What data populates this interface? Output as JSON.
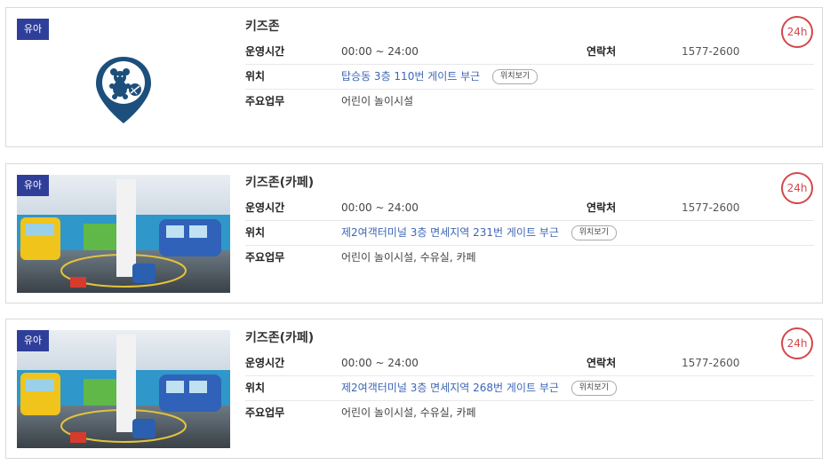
{
  "cards": [
    {
      "badge": "유아",
      "title": "키즈존",
      "hours_badge": "24h",
      "hours_label": "운영시간",
      "hours_value": "00:00 ~ 24:00",
      "contact_label": "연락처",
      "contact_value": "1577-2600",
      "location_label": "위치",
      "location_value": "탑승동 3층 110번 게이트 부근",
      "map_button": "위치보기",
      "duty_label": "주요업무",
      "duty_value": "어린이 놀이시설",
      "image": "kidzone-location-pin-icon"
    },
    {
      "badge": "유아",
      "title": "키즈존(카페)",
      "hours_badge": "24h",
      "hours_label": "운영시간",
      "hours_value": "00:00 ~ 24:00",
      "contact_label": "연락처",
      "contact_value": "1577-2600",
      "location_label": "위치",
      "location_value": "제2여객터미널 3층 면세지역 231번 게이트 부근",
      "map_button": "위치보기",
      "duty_label": "주요업무",
      "duty_value": "어린이 놀이시설, 수유실, 카페",
      "image": "kidzone-photo"
    },
    {
      "badge": "유아",
      "title": "키즈존(카페)",
      "hours_badge": "24h",
      "hours_label": "운영시간",
      "hours_value": "00:00 ~ 24:00",
      "contact_label": "연락처",
      "contact_value": "1577-2600",
      "location_label": "위치",
      "location_value": "제2여객터미널 3층 면세지역 268번 게이트 부근",
      "map_button": "위치보기",
      "duty_label": "주요업무",
      "duty_value": "어린이 놀이시설, 수유실, 카페",
      "image": "kidzone-photo"
    }
  ],
  "colors": {
    "badge_bg": "#2f3f99",
    "hours_red": "#d4474a",
    "link_blue": "#3e66b4",
    "pin_navy": "#1d4f7c"
  }
}
